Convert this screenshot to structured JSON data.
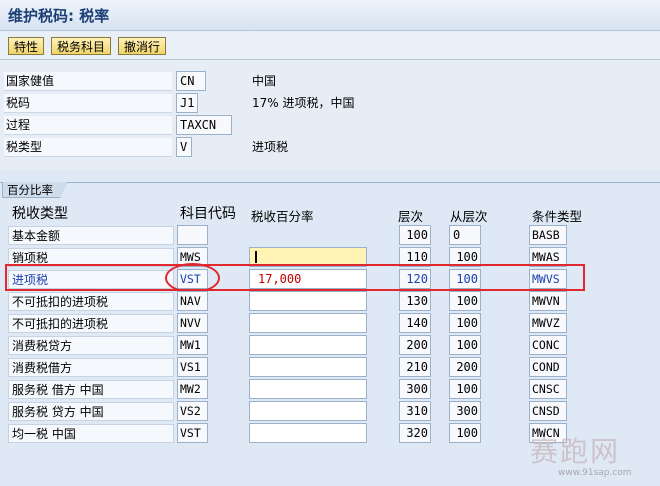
{
  "title": "维护税码: 税率",
  "toolbar": {
    "buttons": [
      "特性",
      "税务科目",
      "撤消行"
    ]
  },
  "header": {
    "fields": [
      {
        "label": "国家健值",
        "value": "CN",
        "desc": "中国"
      },
      {
        "label": "税码",
        "value": "J1",
        "desc": "17% 进项税，中国"
      },
      {
        "label": "过程",
        "value": "TAXCN",
        "desc": ""
      },
      {
        "label": "税类型",
        "value": "V",
        "desc": "进项税"
      }
    ]
  },
  "tab": {
    "label": "百分比率"
  },
  "columns": {
    "tax_type": "税收类型",
    "account_key": "科目代码",
    "rate": "税收百分率",
    "level": "层次",
    "from_level": "从层次",
    "cond_type": "条件类型"
  },
  "rows": [
    {
      "label": "基本金额",
      "code": "",
      "rate": "",
      "level": "100",
      "from": "0",
      "cond": "BASB"
    },
    {
      "label": "销项税",
      "code": "MWS",
      "rate": "",
      "level": "110",
      "from": "100",
      "cond": "MWAS"
    },
    {
      "label": "进项税",
      "code": "VST",
      "rate": "17,000",
      "level": "120",
      "from": "100",
      "cond": "MWVS"
    },
    {
      "label": "不可抵扣的进项税",
      "code": "NAV",
      "rate": "",
      "level": "130",
      "from": "100",
      "cond": "MWVN"
    },
    {
      "label": "不可抵扣的进项税",
      "code": "NVV",
      "rate": "",
      "level": "140",
      "from": "100",
      "cond": "MWVZ"
    },
    {
      "label": "消费税贷方",
      "code": "MW1",
      "rate": "",
      "level": "200",
      "from": "100",
      "cond": "CONC"
    },
    {
      "label": "消费税借方",
      "code": "VS1",
      "rate": "",
      "level": "210",
      "from": "200",
      "cond": "COND"
    },
    {
      "label": "服务税 借方 中国",
      "code": "MW2",
      "rate": "",
      "level": "300",
      "from": "100",
      "cond": "CNSC"
    },
    {
      "label": "服务税 贷方 中国",
      "code": "VS2",
      "rate": "",
      "level": "310",
      "from": "300",
      "cond": "CNSD"
    },
    {
      "label": "均一税 中国",
      "code": "VST",
      "rate": "",
      "level": "320",
      "from": "100",
      "cond": "MWCN"
    }
  ],
  "watermark": {
    "text": "赛跑网",
    "url": "www.91sap.com"
  }
}
